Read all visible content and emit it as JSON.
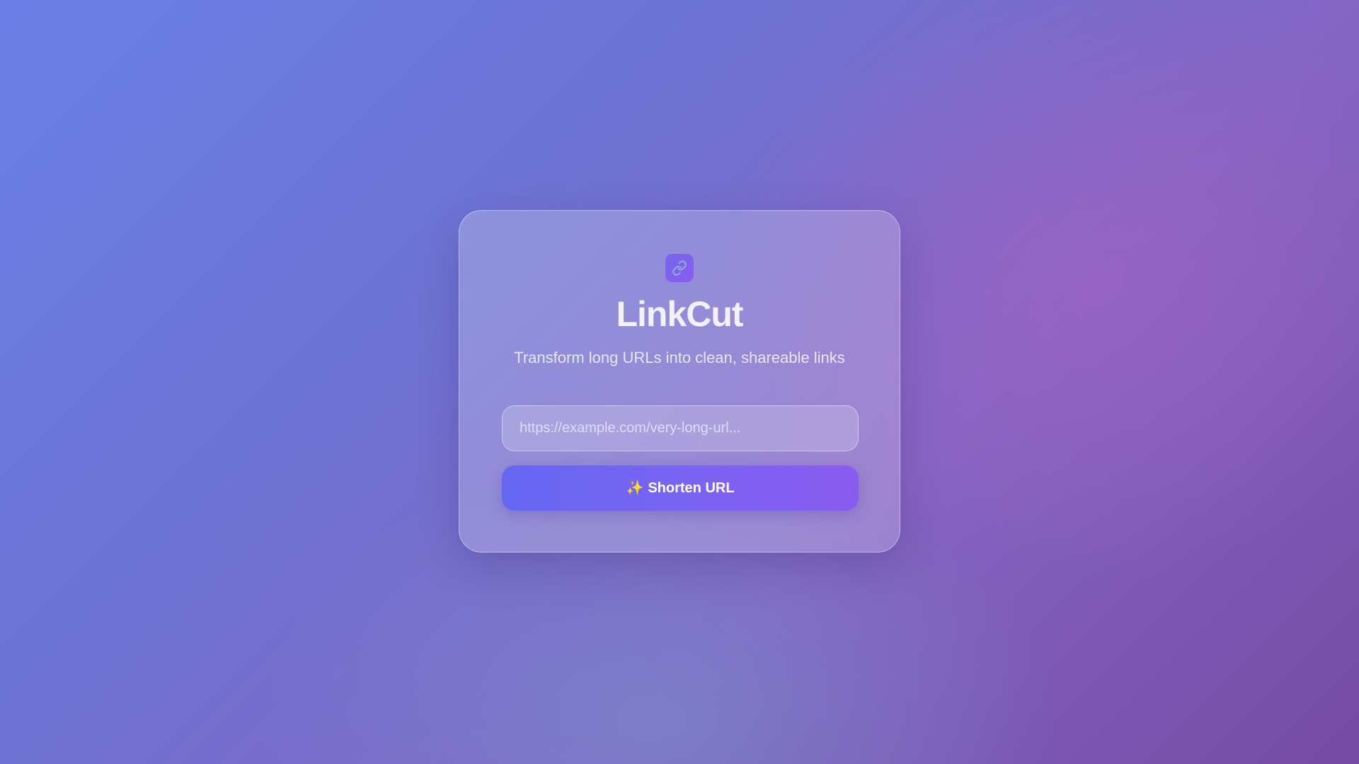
{
  "app": {
    "logo_icon": "link-icon",
    "title": "LinkCut",
    "subtitle": "Transform long URLs into clean, shareable links"
  },
  "form": {
    "url_placeholder": "https://example.com/very-long-url...",
    "url_value": "",
    "submit_icon": "sparkles-icon",
    "submit_label": "Shorten URL"
  },
  "colors": {
    "background_start": "#6a7fe6",
    "background_end": "#744ba3",
    "accent": "#7466ee",
    "button_gradient_start": "#6567f1",
    "button_gradient_end": "#8a5bf0"
  }
}
